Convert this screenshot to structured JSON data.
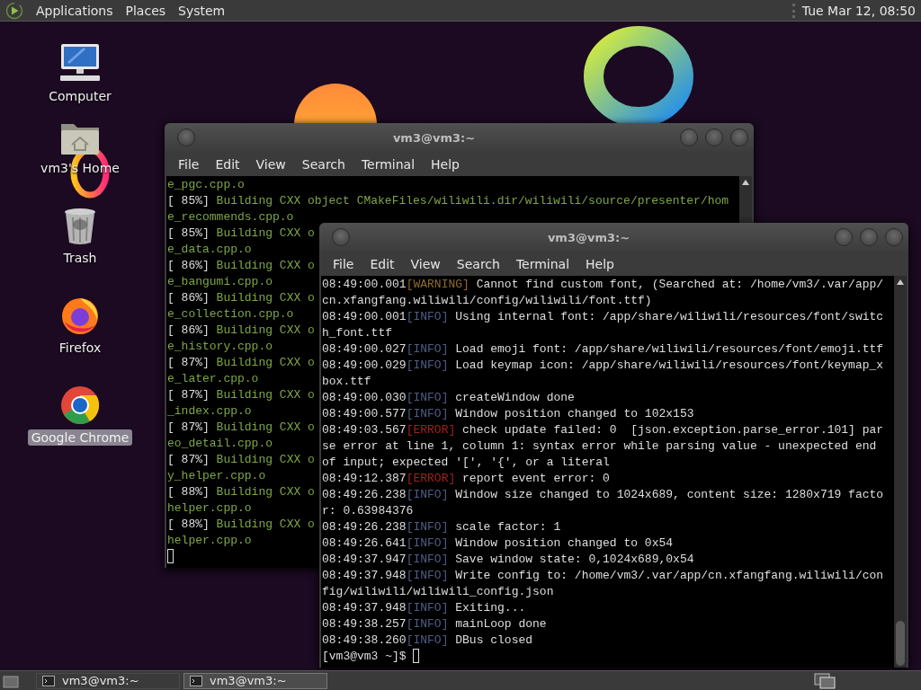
{
  "top_panel": {
    "menus": [
      "Applications",
      "Places",
      "System"
    ],
    "clock": "Tue Mar 12, 08:50"
  },
  "desktop_icons": [
    {
      "label": "Computer",
      "kind": "computer",
      "selected": false
    },
    {
      "label": "vm3's Home",
      "kind": "home",
      "selected": false
    },
    {
      "label": "Trash",
      "kind": "trash",
      "selected": false
    },
    {
      "label": "Firefox",
      "kind": "firefox",
      "selected": false
    },
    {
      "label": "Google Chrome",
      "kind": "chrome",
      "selected": true
    }
  ],
  "windows": [
    {
      "title": "vm3@vm3:~",
      "menus": [
        "File",
        "Edit",
        "View",
        "Search",
        "Terminal",
        "Help"
      ],
      "lines": [
        [
          {
            "text": "e_pgc.cpp.o",
            "kind": "build"
          }
        ],
        [
          {
            "text": "[ 85%]",
            "kind": "plain"
          },
          {
            "text": " Building CXX object CMakeFiles/wiliwili.dir/wiliwili/source/presenter/hom",
            "kind": "build"
          }
        ],
        [
          {
            "text": "e_recommends.cpp.o",
            "kind": "build"
          }
        ],
        [
          {
            "text": "[ 85%]",
            "kind": "plain"
          },
          {
            "text": " Building CXX o",
            "kind": "build"
          }
        ],
        [
          {
            "text": "e_data.cpp.o",
            "kind": "build"
          }
        ],
        [
          {
            "text": "[ 86%]",
            "kind": "plain"
          },
          {
            "text": " Building CXX o",
            "kind": "build"
          }
        ],
        [
          {
            "text": "e_bangumi.cpp.o",
            "kind": "build"
          }
        ],
        [
          {
            "text": "[ 86%]",
            "kind": "plain"
          },
          {
            "text": " Building CXX o",
            "kind": "build"
          }
        ],
        [
          {
            "text": "e_collection.cpp.o",
            "kind": "build"
          }
        ],
        [
          {
            "text": "[ 86%]",
            "kind": "plain"
          },
          {
            "text": " Building CXX o",
            "kind": "build"
          }
        ],
        [
          {
            "text": "e_history.cpp.o",
            "kind": "build"
          }
        ],
        [
          {
            "text": "[ 87%]",
            "kind": "plain"
          },
          {
            "text": " Building CXX o",
            "kind": "build"
          }
        ],
        [
          {
            "text": "e_later.cpp.o",
            "kind": "build"
          }
        ],
        [
          {
            "text": "[ 87%]",
            "kind": "plain"
          },
          {
            "text": " Building CXX o",
            "kind": "build"
          }
        ],
        [
          {
            "text": "_index.cpp.o",
            "kind": "build"
          }
        ],
        [
          {
            "text": "[ 87%]",
            "kind": "plain"
          },
          {
            "text": " Building CXX o",
            "kind": "build"
          }
        ],
        [
          {
            "text": "eo_detail.cpp.o",
            "kind": "build"
          }
        ],
        [
          {
            "text": "[ 87%]",
            "kind": "plain"
          },
          {
            "text": " Building CXX o",
            "kind": "build"
          }
        ],
        [
          {
            "text": "y_helper.cpp.o",
            "kind": "build"
          }
        ],
        [
          {
            "text": "[ 88%]",
            "kind": "plain"
          },
          {
            "text": " Building CXX o",
            "kind": "build"
          }
        ],
        [
          {
            "text": "helper.cpp.o",
            "kind": "build"
          }
        ],
        [
          {
            "text": "[ 88%]",
            "kind": "plain"
          },
          {
            "text": " Building CXX o",
            "kind": "build"
          }
        ],
        [
          {
            "text": "helper.cpp.o",
            "kind": "build"
          }
        ],
        [
          {
            "kind": "cursor"
          }
        ]
      ]
    },
    {
      "title": "vm3@vm3:~",
      "menus": [
        "File",
        "Edit",
        "View",
        "Search",
        "Terminal",
        "Help"
      ],
      "lines": [
        [
          {
            "text": "08:49:00.001",
            "kind": "plain"
          },
          {
            "text": "[WARNING]",
            "kind": "warning"
          },
          {
            "text": " Cannot find custom font, (Searched at: /home/vm3/.var/app/",
            "kind": "plain"
          }
        ],
        [
          {
            "text": "cn.xfangfang.wiliwili/config/wiliwili/font.ttf)",
            "kind": "plain"
          }
        ],
        [
          {
            "text": "08:49:00.001",
            "kind": "plain"
          },
          {
            "text": "[INFO]",
            "kind": "info"
          },
          {
            "text": " Using internal font: /app/share/wiliwili/resources/font/switc",
            "kind": "plain"
          }
        ],
        [
          {
            "text": "h_font.ttf",
            "kind": "plain"
          }
        ],
        [
          {
            "text": "08:49:00.027",
            "kind": "plain"
          },
          {
            "text": "[INFO]",
            "kind": "info"
          },
          {
            "text": " Load emoji font: /app/share/wiliwili/resources/font/emoji.ttf",
            "kind": "plain"
          }
        ],
        [
          {
            "text": "08:49:00.029",
            "kind": "plain"
          },
          {
            "text": "[INFO]",
            "kind": "info"
          },
          {
            "text": " Load keymap icon: /app/share/wiliwili/resources/font/keymap_x",
            "kind": "plain"
          }
        ],
        [
          {
            "text": "box.ttf",
            "kind": "plain"
          }
        ],
        [
          {
            "text": "08:49:00.030",
            "kind": "plain"
          },
          {
            "text": "[INFO]",
            "kind": "info"
          },
          {
            "text": " createWindow done",
            "kind": "plain"
          }
        ],
        [
          {
            "text": "08:49:00.577",
            "kind": "plain"
          },
          {
            "text": "[INFO]",
            "kind": "info"
          },
          {
            "text": " Window position changed to 102x153",
            "kind": "plain"
          }
        ],
        [
          {
            "text": "08:49:03.567",
            "kind": "plain"
          },
          {
            "text": "[ERROR]",
            "kind": "error"
          },
          {
            "text": " check update failed: 0  [json.exception.parse_error.101] par",
            "kind": "plain"
          }
        ],
        [
          {
            "text": "se error at line 1, column 1: syntax error while parsing value - unexpected end",
            "kind": "plain"
          }
        ],
        [
          {
            "text": "of input; expected '[', '{', or a literal",
            "kind": "plain"
          }
        ],
        [
          {
            "text": "08:49:12.387",
            "kind": "plain"
          },
          {
            "text": "[ERROR]",
            "kind": "error"
          },
          {
            "text": " report event error: 0",
            "kind": "plain"
          }
        ],
        [
          {
            "text": "08:49:26.238",
            "kind": "plain"
          },
          {
            "text": "[INFO]",
            "kind": "info"
          },
          {
            "text": " Window size changed to 1024x689, content size: 1280x719 facto",
            "kind": "plain"
          }
        ],
        [
          {
            "text": "r: 0.63984376",
            "kind": "plain"
          }
        ],
        [
          {
            "text": "08:49:26.238",
            "kind": "plain"
          },
          {
            "text": "[INFO]",
            "kind": "info"
          },
          {
            "text": " scale factor: 1",
            "kind": "plain"
          }
        ],
        [
          {
            "text": "08:49:26.641",
            "kind": "plain"
          },
          {
            "text": "[INFO]",
            "kind": "info"
          },
          {
            "text": " Window position changed to 0x54",
            "kind": "plain"
          }
        ],
        [
          {
            "text": "08:49:37.947",
            "kind": "plain"
          },
          {
            "text": "[INFO]",
            "kind": "info"
          },
          {
            "text": " Save window state: 0,1024x689,0x54",
            "kind": "plain"
          }
        ],
        [
          {
            "text": "08:49:37.948",
            "kind": "plain"
          },
          {
            "text": "[INFO]",
            "kind": "info"
          },
          {
            "text": " Write config to: /home/vm3/.var/app/cn.xfangfang.wiliwili/con",
            "kind": "plain"
          }
        ],
        [
          {
            "text": "fig/wiliwili/wiliwili_config.json",
            "kind": "plain"
          }
        ],
        [
          {
            "text": "08:49:37.948",
            "kind": "plain"
          },
          {
            "text": "[INFO]",
            "kind": "info"
          },
          {
            "text": " Exiting...",
            "kind": "plain"
          }
        ],
        [
          {
            "text": "08:49:38.257",
            "kind": "plain"
          },
          {
            "text": "[INFO]",
            "kind": "info"
          },
          {
            "text": " mainLoop done",
            "kind": "plain"
          }
        ],
        [
          {
            "text": "08:49:38.260",
            "kind": "plain"
          },
          {
            "text": "[INFO]",
            "kind": "info"
          },
          {
            "text": " DBus closed",
            "kind": "plain"
          }
        ],
        [
          {
            "text": "[vm3@vm3 ~]$ ",
            "kind": "plain"
          },
          {
            "kind": "cursor"
          }
        ]
      ]
    }
  ],
  "taskbar": {
    "tasks": [
      {
        "label": "vm3@vm3:~",
        "selected": false
      },
      {
        "label": "vm3@vm3:~",
        "selected": true
      }
    ]
  }
}
